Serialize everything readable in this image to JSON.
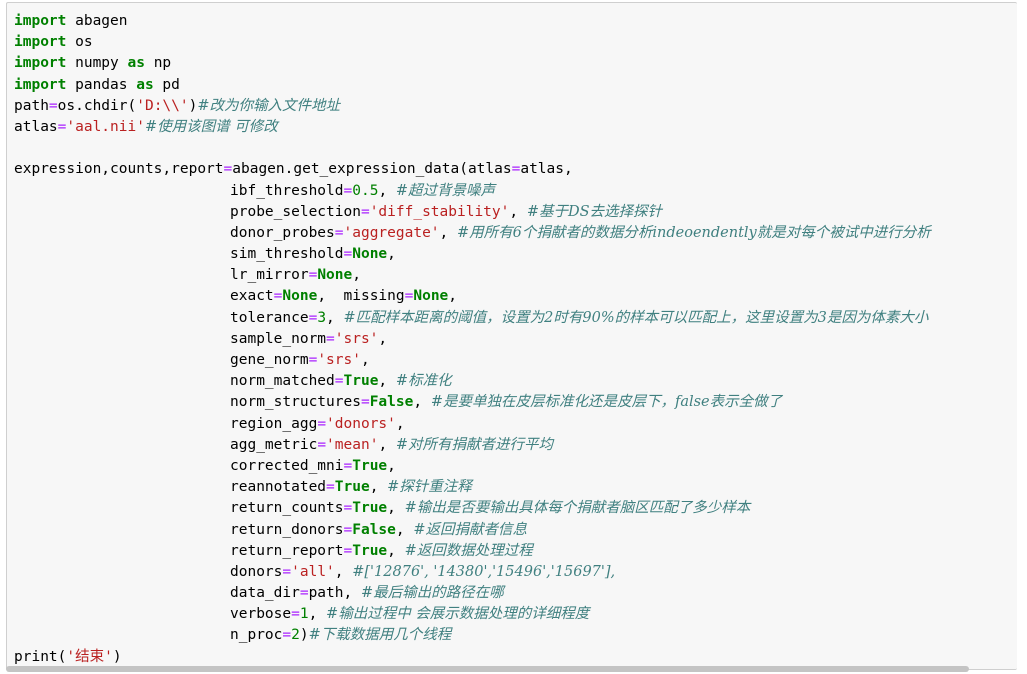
{
  "lines": [
    {
      "indent": false,
      "tokens": [
        {
          "t": "kw",
          "v": "import"
        },
        {
          "t": "pl",
          "v": " abagen"
        }
      ]
    },
    {
      "indent": false,
      "tokens": [
        {
          "t": "kw",
          "v": "import"
        },
        {
          "t": "pl",
          "v": " os"
        }
      ]
    },
    {
      "indent": false,
      "tokens": [
        {
          "t": "kw",
          "v": "import"
        },
        {
          "t": "pl",
          "v": " numpy "
        },
        {
          "t": "kw",
          "v": "as"
        },
        {
          "t": "pl",
          "v": " np"
        }
      ]
    },
    {
      "indent": false,
      "tokens": [
        {
          "t": "kw",
          "v": "import"
        },
        {
          "t": "pl",
          "v": " pandas "
        },
        {
          "t": "kw",
          "v": "as"
        },
        {
          "t": "pl",
          "v": " pd"
        }
      ]
    },
    {
      "indent": false,
      "tokens": [
        {
          "t": "pl",
          "v": "path"
        },
        {
          "t": "op",
          "v": "="
        },
        {
          "t": "pl",
          "v": "os.chdir("
        },
        {
          "t": "str",
          "v": "'D:\\\\'"
        },
        {
          "t": "pl",
          "v": ")"
        },
        {
          "t": "cm",
          "v": "#改为你输入文件地址"
        }
      ]
    },
    {
      "indent": false,
      "tokens": [
        {
          "t": "pl",
          "v": "atlas"
        },
        {
          "t": "op",
          "v": "="
        },
        {
          "t": "str",
          "v": "'aal.nii'"
        },
        {
          "t": "cm",
          "v": "#使用该图谱 可修改"
        }
      ]
    },
    {
      "indent": false,
      "tokens": []
    },
    {
      "indent": false,
      "tokens": [
        {
          "t": "pl",
          "v": "expression,counts,report"
        },
        {
          "t": "op",
          "v": "="
        },
        {
          "t": "pl",
          "v": "abagen.get_expression_data(atlas"
        },
        {
          "t": "op",
          "v": "="
        },
        {
          "t": "pl",
          "v": "atlas,"
        }
      ]
    },
    {
      "indent": true,
      "tokens": [
        {
          "t": "pl",
          "v": "ibf_threshold"
        },
        {
          "t": "op",
          "v": "="
        },
        {
          "t": "num",
          "v": "0.5"
        },
        {
          "t": "pl",
          "v": ", "
        },
        {
          "t": "cm",
          "v": "#超过背景噪声"
        }
      ]
    },
    {
      "indent": true,
      "tokens": [
        {
          "t": "pl",
          "v": "probe_selection"
        },
        {
          "t": "op",
          "v": "="
        },
        {
          "t": "str",
          "v": "'diff_stability'"
        },
        {
          "t": "pl",
          "v": ", "
        },
        {
          "t": "cm",
          "v": "#基于DS去选择探针"
        }
      ]
    },
    {
      "indent": true,
      "tokens": [
        {
          "t": "pl",
          "v": "donor_probes"
        },
        {
          "t": "op",
          "v": "="
        },
        {
          "t": "str",
          "v": "'aggregate'"
        },
        {
          "t": "pl",
          "v": ", "
        },
        {
          "t": "cm",
          "v": "#用所有6个捐献者的数据分析indeoendently就是对每个被试中进行分析"
        }
      ]
    },
    {
      "indent": true,
      "tokens": [
        {
          "t": "pl",
          "v": "sim_threshold"
        },
        {
          "t": "op",
          "v": "="
        },
        {
          "t": "kw",
          "v": "None"
        },
        {
          "t": "pl",
          "v": ","
        }
      ]
    },
    {
      "indent": true,
      "tokens": [
        {
          "t": "pl",
          "v": "lr_mirror"
        },
        {
          "t": "op",
          "v": "="
        },
        {
          "t": "kw",
          "v": "None"
        },
        {
          "t": "pl",
          "v": ","
        }
      ]
    },
    {
      "indent": true,
      "tokens": [
        {
          "t": "pl",
          "v": "exact"
        },
        {
          "t": "op",
          "v": "="
        },
        {
          "t": "kw",
          "v": "None"
        },
        {
          "t": "pl",
          "v": ",  missing"
        },
        {
          "t": "op",
          "v": "="
        },
        {
          "t": "kw",
          "v": "None"
        },
        {
          "t": "pl",
          "v": ","
        }
      ]
    },
    {
      "indent": true,
      "tokens": [
        {
          "t": "pl",
          "v": "tolerance"
        },
        {
          "t": "op",
          "v": "="
        },
        {
          "t": "num",
          "v": "3"
        },
        {
          "t": "pl",
          "v": ", "
        },
        {
          "t": "cm",
          "v": "#匹配样本距离的阈值，设置为2时有90%的样本可以匹配上，这里设置为3是因为体素大小"
        }
      ]
    },
    {
      "indent": true,
      "tokens": [
        {
          "t": "pl",
          "v": "sample_norm"
        },
        {
          "t": "op",
          "v": "="
        },
        {
          "t": "str",
          "v": "'srs'"
        },
        {
          "t": "pl",
          "v": ","
        }
      ]
    },
    {
      "indent": true,
      "tokens": [
        {
          "t": "pl",
          "v": "gene_norm"
        },
        {
          "t": "op",
          "v": "="
        },
        {
          "t": "str",
          "v": "'srs'"
        },
        {
          "t": "pl",
          "v": ","
        }
      ]
    },
    {
      "indent": true,
      "tokens": [
        {
          "t": "pl",
          "v": "norm_matched"
        },
        {
          "t": "op",
          "v": "="
        },
        {
          "t": "kw",
          "v": "True"
        },
        {
          "t": "pl",
          "v": ", "
        },
        {
          "t": "cm",
          "v": "#标准化"
        }
      ]
    },
    {
      "indent": true,
      "tokens": [
        {
          "t": "pl",
          "v": "norm_structures"
        },
        {
          "t": "op",
          "v": "="
        },
        {
          "t": "kw",
          "v": "False"
        },
        {
          "t": "pl",
          "v": ", "
        },
        {
          "t": "cm",
          "v": "#是要单独在皮层标准化还是皮层下，false表示全做了"
        }
      ]
    },
    {
      "indent": true,
      "tokens": [
        {
          "t": "pl",
          "v": "region_agg"
        },
        {
          "t": "op",
          "v": "="
        },
        {
          "t": "str",
          "v": "'donors'"
        },
        {
          "t": "pl",
          "v": ","
        }
      ]
    },
    {
      "indent": true,
      "tokens": [
        {
          "t": "pl",
          "v": "agg_metric"
        },
        {
          "t": "op",
          "v": "="
        },
        {
          "t": "str",
          "v": "'mean'"
        },
        {
          "t": "pl",
          "v": ", "
        },
        {
          "t": "cm",
          "v": "#对所有捐献者进行平均"
        }
      ]
    },
    {
      "indent": true,
      "tokens": [
        {
          "t": "pl",
          "v": "corrected_mni"
        },
        {
          "t": "op",
          "v": "="
        },
        {
          "t": "kw",
          "v": "True"
        },
        {
          "t": "pl",
          "v": ","
        }
      ]
    },
    {
      "indent": true,
      "tokens": [
        {
          "t": "pl",
          "v": "reannotated"
        },
        {
          "t": "op",
          "v": "="
        },
        {
          "t": "kw",
          "v": "True"
        },
        {
          "t": "pl",
          "v": ", "
        },
        {
          "t": "cm",
          "v": "#探针重注释"
        }
      ]
    },
    {
      "indent": true,
      "tokens": [
        {
          "t": "pl",
          "v": "return_counts"
        },
        {
          "t": "op",
          "v": "="
        },
        {
          "t": "kw",
          "v": "True"
        },
        {
          "t": "pl",
          "v": ", "
        },
        {
          "t": "cm",
          "v": "#输出是否要输出具体每个捐献者脑区匹配了多少样本"
        }
      ]
    },
    {
      "indent": true,
      "tokens": [
        {
          "t": "pl",
          "v": "return_donors"
        },
        {
          "t": "op",
          "v": "="
        },
        {
          "t": "kw",
          "v": "False"
        },
        {
          "t": "pl",
          "v": ", "
        },
        {
          "t": "cm",
          "v": "#返回捐献者信息"
        }
      ]
    },
    {
      "indent": true,
      "tokens": [
        {
          "t": "pl",
          "v": "return_report"
        },
        {
          "t": "op",
          "v": "="
        },
        {
          "t": "kw",
          "v": "True"
        },
        {
          "t": "pl",
          "v": ", "
        },
        {
          "t": "cm",
          "v": "#返回数据处理过程"
        }
      ]
    },
    {
      "indent": true,
      "tokens": [
        {
          "t": "pl",
          "v": "donors"
        },
        {
          "t": "op",
          "v": "="
        },
        {
          "t": "str",
          "v": "'all'"
        },
        {
          "t": "pl",
          "v": ", "
        },
        {
          "t": "cm",
          "v": "#['12876', '14380','15496','15697'],"
        }
      ]
    },
    {
      "indent": true,
      "tokens": [
        {
          "t": "pl",
          "v": "data_dir"
        },
        {
          "t": "op",
          "v": "="
        },
        {
          "t": "pl",
          "v": "path, "
        },
        {
          "t": "cm",
          "v": "#最后输出的路径在哪"
        }
      ]
    },
    {
      "indent": true,
      "tokens": [
        {
          "t": "pl",
          "v": "verbose"
        },
        {
          "t": "op",
          "v": "="
        },
        {
          "t": "num",
          "v": "1"
        },
        {
          "t": "pl",
          "v": ", "
        },
        {
          "t": "cm",
          "v": "#输出过程中 会展示数据处理的详细程度"
        }
      ]
    },
    {
      "indent": true,
      "tokens": [
        {
          "t": "pl",
          "v": "n_proc"
        },
        {
          "t": "op",
          "v": "="
        },
        {
          "t": "num",
          "v": "2"
        },
        {
          "t": "pl",
          "v": ")"
        },
        {
          "t": "cm",
          "v": "#下载数据用几个线程"
        }
      ]
    },
    {
      "indent": false,
      "tokens": [
        {
          "t": "pl",
          "v": "print("
        },
        {
          "t": "str",
          "v": "'结束'"
        },
        {
          "t": "pl",
          "v": ")"
        }
      ]
    }
  ]
}
